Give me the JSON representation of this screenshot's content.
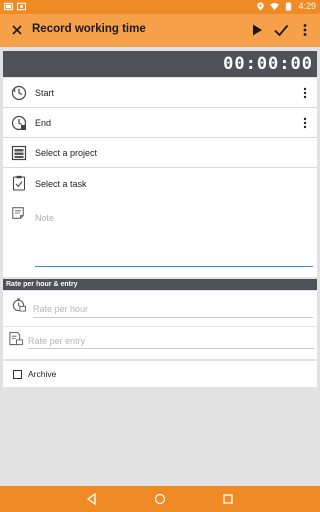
{
  "status_bar": {
    "time": "4:29"
  },
  "app_bar": {
    "title": "Record working time",
    "icons": [
      "close-icon",
      "play-icon",
      "check-icon",
      "overflow-icon"
    ]
  },
  "timer": {
    "display": "00:00:00"
  },
  "fields": {
    "start": {
      "label": "Start",
      "icon": "clock-icon"
    },
    "end": {
      "label": "End",
      "icon": "clock-stop-icon"
    },
    "project": {
      "label": "Select a project",
      "icon": "project-icon"
    },
    "task": {
      "label": "Select a task",
      "icon": "task-icon"
    }
  },
  "note": {
    "placeholder": "Note",
    "icon": "note-icon"
  },
  "rate_section": {
    "header": "Rate per hour & entry",
    "rate_per_hour_placeholder": "Rate per hour",
    "rate_per_entry_placeholder": "Rate per entry"
  },
  "archive": {
    "label": "Archive",
    "checked": false
  },
  "colors": {
    "accent": "#f6a04a",
    "status_bar": "#f08a24",
    "dark_header": "#505058",
    "focus_line": "#3b8fb7"
  }
}
